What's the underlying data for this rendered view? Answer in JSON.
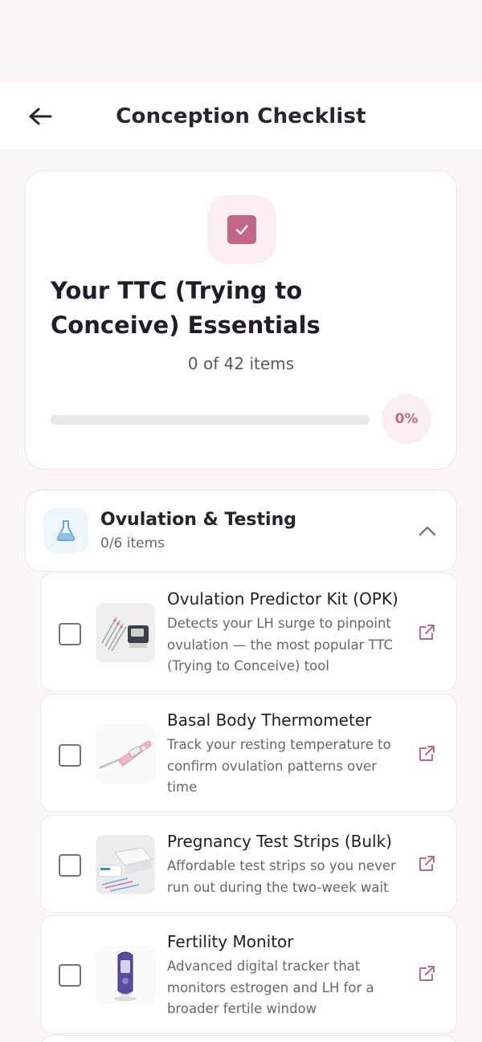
{
  "header": {
    "title": "Conception Checklist",
    "back_icon": "arrow-left-icon"
  },
  "summary": {
    "title": "Your TTC (Trying to Conceive) Essentials",
    "items_text": "0 of 42 items",
    "progress_percent_label": "0%",
    "progress_fraction": 0,
    "accent_color": "#c2668c"
  },
  "section": {
    "icon": "flask-icon",
    "title": "Ovulation & Testing",
    "count": "0/6 items",
    "expanded": true
  },
  "items": [
    {
      "title": "Ovulation Predictor Kit (OPK)",
      "description": "Detects your LH surge to pinpoint ovulation — the most popular TTC (Trying to Conceive) tool",
      "checked": false,
      "thumb": "opk-kit-image"
    },
    {
      "title": "Basal Body Thermometer",
      "description": "Track your resting temperature to confirm ovulation patterns over time",
      "checked": false,
      "thumb": "thermometer-image"
    },
    {
      "title": "Pregnancy Test Strips (Bulk)",
      "description": "Affordable test strips so you never run out during the two-week wait",
      "checked": false,
      "thumb": "test-strips-image"
    },
    {
      "title": "Fertility Monitor",
      "description": "Advanced digital tracker that monitors estrogen and LH for a broader fertile window",
      "checked": false,
      "thumb": "fertility-monitor-image"
    }
  ]
}
